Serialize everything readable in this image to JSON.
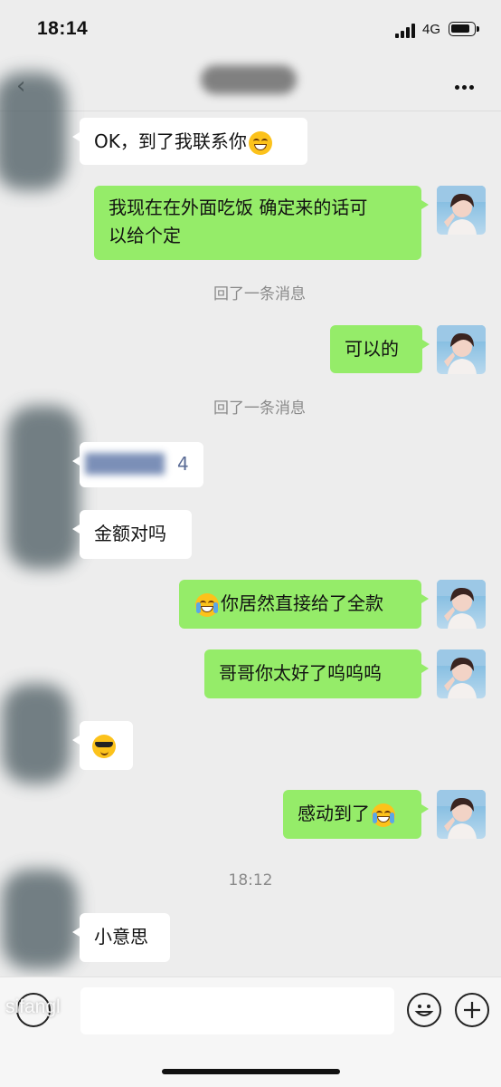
{
  "status": {
    "time": "18:14",
    "network": "4G"
  },
  "nav": {
    "title": "",
    "back_icon": "chevron-left-icon",
    "more_icon": "more-icon"
  },
  "messages": [
    {
      "side": "in",
      "text": "OK，到了我联系你"
    },
    {
      "side": "out",
      "line1": "我现在在外面吃饭 确定来的话可",
      "line2": "以给个定"
    },
    {
      "system": "回了一条消息"
    },
    {
      "side": "out",
      "text": "可以的"
    },
    {
      "system": "回了一条消息"
    },
    {
      "side": "in",
      "text": "4"
    },
    {
      "side": "in",
      "text": "金额对吗"
    },
    {
      "side": "out",
      "text": "你居然直接给了全款"
    },
    {
      "side": "out",
      "text": "哥哥你太好了呜呜呜"
    },
    {
      "side": "in",
      "text": ""
    },
    {
      "side": "out",
      "text": "感动到了"
    },
    {
      "timestamp": "18:12"
    },
    {
      "side": "in",
      "text": "小意思"
    }
  ],
  "input": {
    "value": "",
    "watermark": "sifangl"
  },
  "colors": {
    "outgoing_bubble": "#95ec69",
    "incoming_bubble": "#ffffff",
    "background": "#ededed"
  }
}
